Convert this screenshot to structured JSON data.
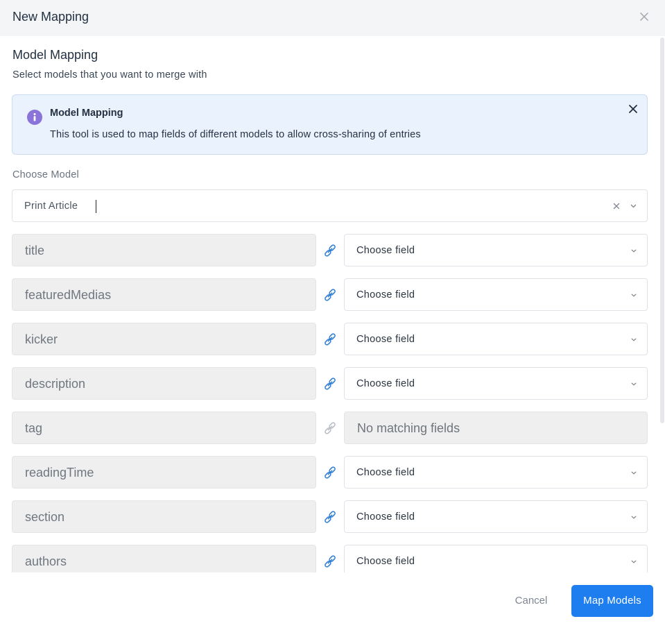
{
  "dialog": {
    "title": "New Mapping"
  },
  "section": {
    "title": "Model Mapping",
    "subtitle": "Select models that you want to merge with"
  },
  "alert": {
    "title": "Model Mapping",
    "text": "This tool is used to map fields of different models to allow cross-sharing of entries"
  },
  "model_select": {
    "label": "Choose Model",
    "value": "Print Article"
  },
  "mappings": [
    {
      "source": "title",
      "target": "Choose field",
      "matchable": true
    },
    {
      "source": "featuredMedias",
      "target": "Choose field",
      "matchable": true
    },
    {
      "source": "kicker",
      "target": "Choose field",
      "matchable": true
    },
    {
      "source": "description",
      "target": "Choose field",
      "matchable": true
    },
    {
      "source": "tag",
      "target": "No matching fields",
      "matchable": false
    },
    {
      "source": "readingTime",
      "target": "Choose field",
      "matchable": true
    },
    {
      "source": "section",
      "target": "Choose field",
      "matchable": true
    },
    {
      "source": "authors",
      "target": "Choose field",
      "matchable": true
    }
  ],
  "footer": {
    "cancel_label": "Cancel",
    "submit_label": "Map Models"
  },
  "colors": {
    "primary": "#1e7ef0",
    "link_icon": "#2f7dd6",
    "link_icon_disabled": "#b9bec5",
    "info_icon": "#8a73d9",
    "alert_bg": "#eaf2fd"
  }
}
